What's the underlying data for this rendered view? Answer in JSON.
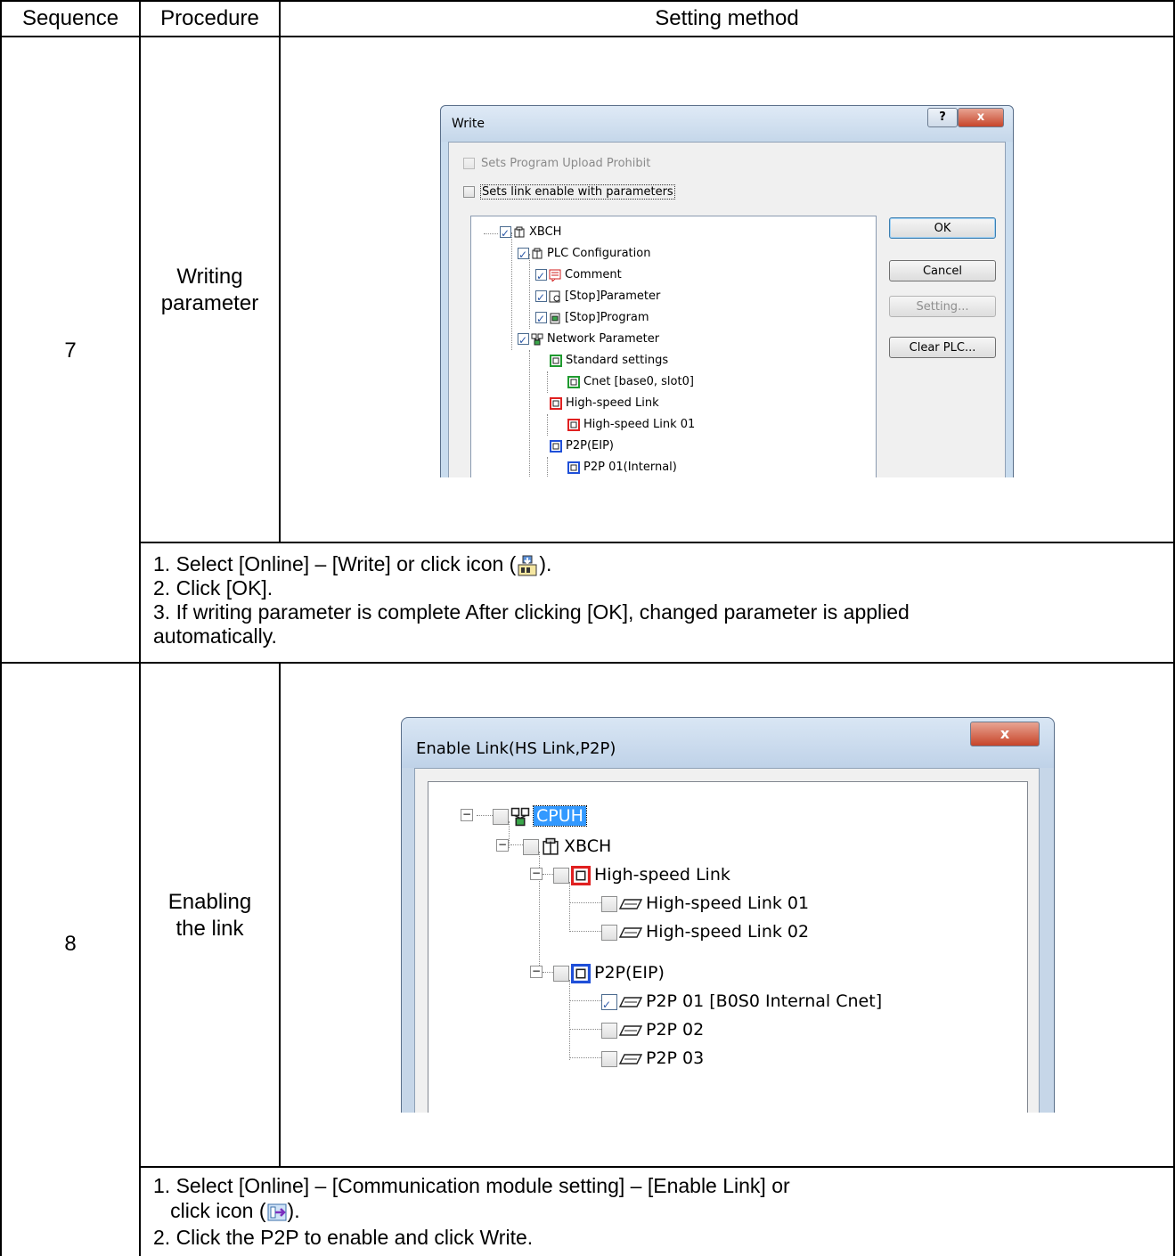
{
  "table": {
    "headers": [
      "Sequence",
      "Procedure",
      "Setting method"
    ],
    "rows": [
      {
        "sequence": "7",
        "procedure": "Writing\nparameter",
        "instructions": [
          "1. Select [Online] – [Write] or click icon (",
          ").",
          "2. Click [OK].",
          "3. If writing parameter is complete After clicking [OK], changed parameter is applied",
          "automatically."
        ]
      },
      {
        "sequence": "8",
        "procedure": "Enabling\nthe link",
        "instructions": [
          "1. Select [Online] – [Communication module setting] – [Enable Link] or",
          "   click icon (",
          ").",
          "2. Click the P2P to enable and click Write."
        ]
      }
    ]
  },
  "write_dialog": {
    "title": "Write",
    "help_glyph": "?",
    "close_glyph": "x",
    "checkbox_upload": "Sets Program Upload Prohibit",
    "checkbox_link": "Sets link enable with parameters",
    "tree": [
      {
        "label": "XBCH",
        "icon": "cpu-icon",
        "checked": true
      },
      {
        "label": "PLC Configuration",
        "icon": "cpu-icon",
        "checked": true
      },
      {
        "label": "Comment",
        "icon": "comment-icon",
        "checked": true
      },
      {
        "label": "[Stop]Parameter",
        "icon": "parameter-icon",
        "checked": true
      },
      {
        "label": "[Stop]Program",
        "icon": "program-icon",
        "checked": true
      },
      {
        "label": "Network Parameter",
        "icon": "network-icon",
        "checked": true
      },
      {
        "label": "Standard settings",
        "icon": "module-icon-green"
      },
      {
        "label": "Cnet [base0, slot0]",
        "icon": "module-icon-green"
      },
      {
        "label": "High-speed Link",
        "icon": "module-icon-red"
      },
      {
        "label": "High-speed Link 01",
        "icon": "module-icon-red"
      },
      {
        "label": "P2P(EIP)",
        "icon": "module-icon-blue"
      },
      {
        "label": "P2P 01(Internal)",
        "icon": "module-icon-blue"
      }
    ],
    "buttons": {
      "ok": "OK",
      "cancel": "Cancel",
      "setting": "Setting...",
      "clear": "Clear PLC..."
    }
  },
  "link_dialog": {
    "title": "Enable Link(HS Link,P2P)",
    "close_glyph": "x",
    "tree": [
      {
        "label": "CPUH",
        "icon": "network-icon",
        "checked": false,
        "selected": true
      },
      {
        "label": "XBCH",
        "icon": "cpu-icon",
        "checked": false
      },
      {
        "label": "High-speed Link",
        "icon": "module-icon-red",
        "checked": false
      },
      {
        "label": "High-speed Link 01",
        "icon": "link-icon",
        "checked": false
      },
      {
        "label": "High-speed Link 02",
        "icon": "link-icon",
        "checked": false
      },
      {
        "label": "P2P(EIP)",
        "icon": "module-icon-blue",
        "checked": false
      },
      {
        "label": "P2P 01 [B0S0 Internal Cnet]",
        "icon": "link-icon",
        "checked": true
      },
      {
        "label": "P2P 02",
        "icon": "link-icon",
        "checked": false
      },
      {
        "label": "P2P 03",
        "icon": "link-icon",
        "checked": false
      }
    ],
    "expander_glyph": "−"
  },
  "colors": {
    "selection": "#3399ff",
    "accent_red": "#e02020",
    "accent_green": "#1f9a2f",
    "accent_blue": "#1f4fd8"
  }
}
